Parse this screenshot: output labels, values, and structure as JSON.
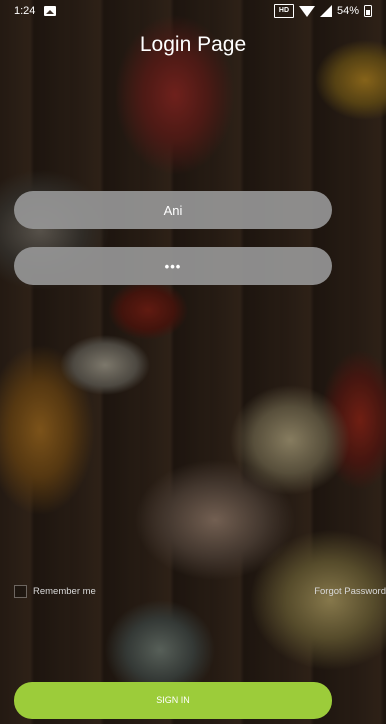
{
  "status_bar": {
    "time": "1:24",
    "battery_percent": "54%",
    "icons": [
      "image-notification-icon",
      "hd-icon",
      "wifi-icon",
      "signal-icon",
      "battery-icon"
    ]
  },
  "page": {
    "title": "Login Page"
  },
  "form": {
    "username_value": "Ani",
    "password_value": "•••",
    "remember_label": "Remember me",
    "remember_checked": false,
    "forgot_label": "Forgot Password",
    "signin_label": "SIGN IN"
  },
  "colors": {
    "field_background": "#969696",
    "signin_background": "#9ccc3a",
    "text": "#ffffff"
  }
}
